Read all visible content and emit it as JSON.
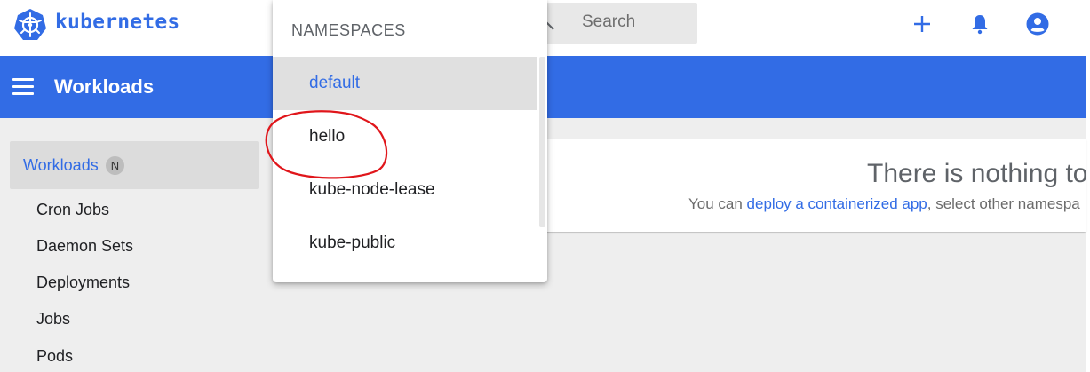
{
  "header": {
    "brand": "kubernetes",
    "search_placeholder": "Search",
    "icons": [
      "kubernetes-logo-icon",
      "search-icon",
      "plus-icon",
      "bell-icon",
      "account-circle-icon"
    ]
  },
  "toolbar": {
    "title": "Workloads",
    "menu_icon": "menu-icon"
  },
  "sidebar": {
    "active": {
      "label": "Workloads",
      "badge": "N"
    },
    "items": [
      {
        "label": "Cron Jobs"
      },
      {
        "label": "Daemon Sets"
      },
      {
        "label": "Deployments"
      },
      {
        "label": "Jobs"
      },
      {
        "label": "Pods"
      }
    ]
  },
  "namespaces": {
    "header": "NAMESPACES",
    "items": [
      {
        "label": "default",
        "selected": true
      },
      {
        "label": "hello",
        "selected": false
      },
      {
        "label": "kube-node-lease",
        "selected": false
      },
      {
        "label": "kube-public",
        "selected": false
      }
    ]
  },
  "main": {
    "empty_title": "There is nothing to",
    "empty_sub_prefix": "You can ",
    "empty_sub_link": "deploy a containerized app",
    "empty_sub_suffix": ", select other namespa"
  },
  "colors": {
    "brand": "#326ce5",
    "annotation": "#e0161b"
  }
}
